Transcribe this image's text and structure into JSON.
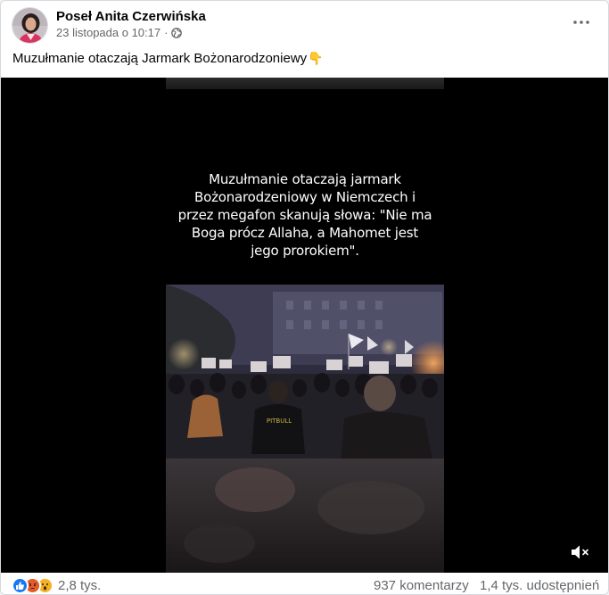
{
  "post": {
    "author": "Poseł Anita Czerwińska",
    "timestamp": "23 listopada o 10:17",
    "separator": "·",
    "audience_icon": "globe-icon",
    "caption": "Muzułmanie otaczają Jarmark Bożonarodzoniewy",
    "caption_emoji": "👇"
  },
  "video": {
    "overlay_lines": [
      "Muzułmanie otaczają jarmark",
      "Bożonarodzeniowy w Niemczech i",
      "przez megafon skanują słowa: \"Nie ma",
      "Boga prócz Allaha, a Mahomet jest",
      "jego prorokiem\"."
    ],
    "jersey_text": "PITBULL",
    "mute_icon": "volume-muted-icon"
  },
  "footer": {
    "reaction_icons": [
      "like-icon",
      "angry-icon",
      "wow-icon"
    ],
    "reaction_count": "2,8 tys.",
    "comments": "937 komentarzy",
    "shares": "1,4 tys. udostępnień"
  },
  "colors": {
    "like_blue": "#1877f2",
    "angry_orange": "#e9710f",
    "wow_yellow": "#f7b125",
    "secondary_text": "#65676b"
  }
}
